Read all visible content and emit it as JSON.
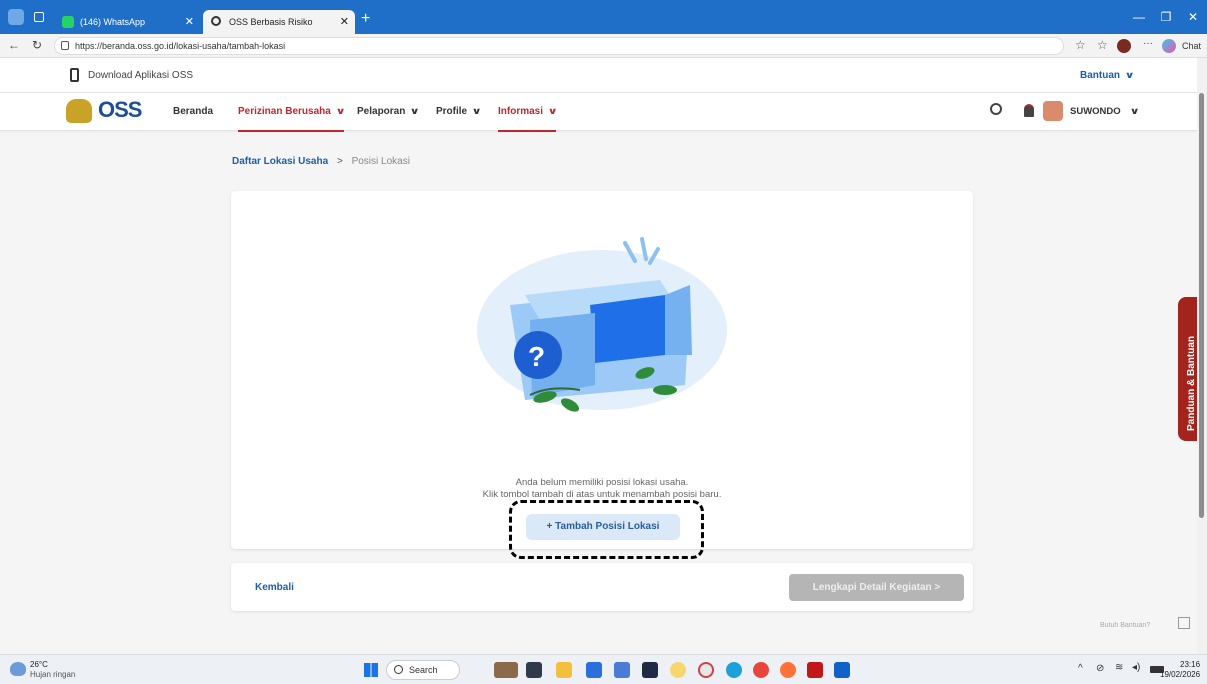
{
  "browser": {
    "tabs": [
      {
        "label": "(146) WhatsApp"
      },
      {
        "label": "OSS Berbasis Risiko"
      }
    ],
    "new_tab": "+",
    "url": "https://beranda.oss.go.id/lokasi-usaha/tambah-lokasi",
    "chat_label": "Chat"
  },
  "topstrip": {
    "download_label": "Download Aplikasi OSS",
    "help_label": "Bantuan"
  },
  "navbar": {
    "logo_text": "OSS",
    "items": [
      {
        "label": "Beranda"
      },
      {
        "label": "Perizinan Berusaha"
      },
      {
        "label": "Pelaporan"
      },
      {
        "label": "Profile"
      },
      {
        "label": "Informasi"
      }
    ],
    "username": "SUWONDO"
  },
  "breadcrumb": {
    "parent": "Daftar Lokasi Usaha",
    "separator": ">",
    "current": "Posisi Lokasi"
  },
  "empty_state": {
    "line1": "Anda belum memiliki posisi lokasi usaha.",
    "line2": "Klik tombol tambah di atas untuk menambah posisi baru.",
    "add_button": "+ Tambah Posisi Lokasi"
  },
  "footer": {
    "back_label": "Kembali",
    "next_label": "Lengkapi Detail Kegiatan  >"
  },
  "side_tab": {
    "label": "Panduan & Bantuan"
  },
  "help_hint": "Butuh Bantuan?",
  "taskbar": {
    "weather_temp": "26°C",
    "weather_desc": "Hujan ringan",
    "search_label": "Search",
    "time": "23:16",
    "date": "19/02/2026"
  },
  "colors": {
    "accent_red": "#c0262c",
    "link_blue": "#1d5ea8",
    "titlebar_blue": "#1f6fc9"
  }
}
